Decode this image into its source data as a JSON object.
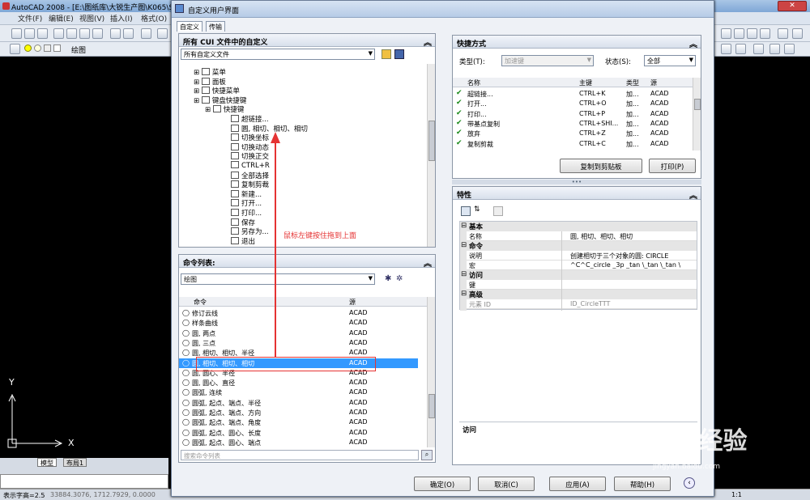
{
  "app": {
    "title": "AutoCAD 2008 - [E:\\图纸库\\大锐生产图\\K065\\S...",
    "menu": [
      "文件(F)",
      "编辑(E)",
      "视图(V)",
      "插入(I)",
      "格式(O)"
    ],
    "toolbar_layer_name": "绘图"
  },
  "drawing": {
    "axis_x": "X",
    "axis_y": "Y",
    "tab_model": "模型",
    "tab_layout": "布局1"
  },
  "status": {
    "left_text": "表示字高=2.5",
    "coords": "33884.3076,  1712.7929,  0.0000",
    "scale": "1:1"
  },
  "dialog": {
    "title": "自定义用户界面",
    "tabs": [
      "自定义",
      "传输"
    ],
    "custom_panel": {
      "header": "所有 CUI 文件中的自定义",
      "combo": "所有自定义文件",
      "tree": [
        {
          "label": "菜单",
          "indent": 0
        },
        {
          "label": "面板",
          "indent": 0
        },
        {
          "label": "快捷菜单",
          "indent": 0
        },
        {
          "label": "键盘快捷键",
          "indent": 0
        },
        {
          "label": "快捷键",
          "indent": 1
        },
        {
          "label": "超链接...",
          "indent": 2
        },
        {
          "label": "圆, 相切、相切、相切",
          "indent": 2
        },
        {
          "label": "切换坐标",
          "indent": 2
        },
        {
          "label": "切换动态",
          "indent": 2
        },
        {
          "label": "切换正交",
          "indent": 2
        },
        {
          "label": "CTRL+R",
          "indent": 2
        },
        {
          "label": "全部选择",
          "indent": 2
        },
        {
          "label": "复制剪裁",
          "indent": 2
        },
        {
          "label": "新建...",
          "indent": 2
        },
        {
          "label": "打开...",
          "indent": 2
        },
        {
          "label": "打印...",
          "indent": 2
        },
        {
          "label": "保存",
          "indent": 2
        },
        {
          "label": "另存为...",
          "indent": 2
        },
        {
          "label": "退出",
          "indent": 2
        }
      ]
    },
    "cmd_panel": {
      "header": "命令列表:",
      "combo": "绘图",
      "col_cmd": "命令",
      "col_src": "源",
      "rows": [
        {
          "cmd": "修订云线",
          "src": "ACAD"
        },
        {
          "cmd": "样条曲线",
          "src": "ACAD"
        },
        {
          "cmd": "圆, 两点",
          "src": "ACAD"
        },
        {
          "cmd": "圆, 三点",
          "src": "ACAD"
        },
        {
          "cmd": "圆, 相切、相切、半径",
          "src": "ACAD"
        },
        {
          "cmd": "圆, 相切、相切、相切",
          "src": "ACAD"
        },
        {
          "cmd": "圆, 圆心、半径",
          "src": "ACAD"
        },
        {
          "cmd": "圆, 圆心、直径",
          "src": "ACAD"
        },
        {
          "cmd": "圆弧, 连续",
          "src": "ACAD"
        },
        {
          "cmd": "圆弧, 起点、端点、半径",
          "src": "ACAD"
        },
        {
          "cmd": "圆弧, 起点、端点、方向",
          "src": "ACAD"
        },
        {
          "cmd": "圆弧, 起点、端点、角度",
          "src": "ACAD"
        },
        {
          "cmd": "圆弧, 起点、圆心、长度",
          "src": "ACAD"
        },
        {
          "cmd": "圆弧, 起点、圆心、端点",
          "src": "ACAD"
        }
      ],
      "selected_index": 5,
      "search_placeholder": "搜索命令列表"
    },
    "shortcut_panel": {
      "header": "快捷方式",
      "type_label": "类型(T):",
      "type_value": "加速键",
      "state_label": "状态(S):",
      "state_value": "全部",
      "cols": [
        "名称",
        "主键",
        "类型",
        "源"
      ],
      "rows": [
        {
          "name": "超链接...",
          "key": "CTRL+K",
          "type": "加...",
          "src": "ACAD"
        },
        {
          "name": "打开...",
          "key": "CTRL+O",
          "type": "加...",
          "src": "ACAD"
        },
        {
          "name": "打印...",
          "key": "CTRL+P",
          "type": "加...",
          "src": "ACAD"
        },
        {
          "name": "带基点复制",
          "key": "CTRL+SHI...",
          "type": "加...",
          "src": "ACAD"
        },
        {
          "name": "放弃",
          "key": "CTRL+Z",
          "type": "加...",
          "src": "ACAD"
        },
        {
          "name": "复制剪裁",
          "key": "CTRL+C",
          "type": "加...",
          "src": "ACAD"
        }
      ],
      "copy_button": "复制到剪贴板",
      "print_button": "打印(P)"
    },
    "props_panel": {
      "header": "特性",
      "cat_basic": "基本",
      "name_label": "名称",
      "name_value": "圆, 相切、相切、相切",
      "cat_command": "命令",
      "desc_label": "说明",
      "desc_value": "创建相切于三个对象的圆:  CIRCLE",
      "macro_label": "宏",
      "macro_value": "^C^C_circle _3p _tan \\_tan \\_tan \\",
      "cat_access": "访问",
      "key_label": "键",
      "key_value": "",
      "cat_advanced": "高级",
      "elem_label": "元素 ID",
      "elem_value": "ID_CircleTTT",
      "help_title": "访问"
    },
    "buttons": {
      "ok": "确定(O)",
      "cancel": "取消(C)",
      "apply": "应用(A)",
      "help": "帮助(H)"
    },
    "annotation": "鼠标左键按住拖到上面"
  },
  "watermark": {
    "brand": "Baidu",
    "cn": "经验",
    "url": "jingyan.baidu.com"
  },
  "colors": {
    "selection": "#3399ff",
    "annotation": "#e53333",
    "check": "#1a8a1a"
  }
}
